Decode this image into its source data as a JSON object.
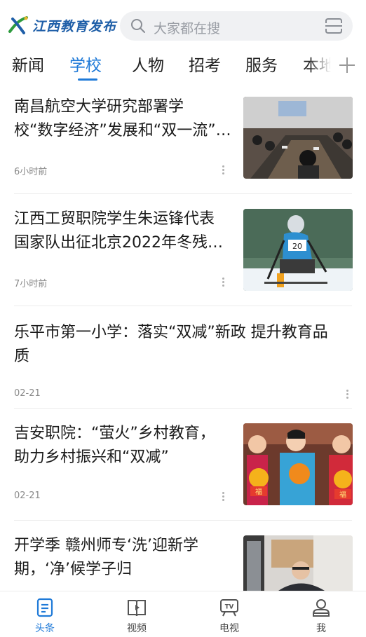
{
  "brand": {
    "name": "江西教育发布",
    "accent": "#1f7ad8"
  },
  "search": {
    "placeholder": "大家都在搜"
  },
  "tabs": [
    {
      "label": "新闻",
      "active": false
    },
    {
      "label": "学校",
      "active": true
    },
    {
      "label": "人物",
      "active": false
    },
    {
      "label": "招考",
      "active": false
    },
    {
      "label": "服务",
      "active": false
    },
    {
      "label": "本地",
      "active": false
    }
  ],
  "feed": [
    {
      "title_line1": "南昌航空大学研究部署学",
      "title_line2": "校“数字经济”发展和“双一流”…",
      "time": "6小时前",
      "has_image": true,
      "image": "meeting-photo"
    },
    {
      "title_line1": "江西工贸职院学生朱运锋代表",
      "title_line2": "国家队出征北京2022年冬残…",
      "time": "7小时前",
      "has_image": true,
      "image": "para-skier-photo",
      "bib": "20"
    },
    {
      "title_line1": "乐平市第一小学：落实“双减”新政  提升教育品",
      "title_line2": "质",
      "time": "02-21",
      "has_image": false
    },
    {
      "title_line1": "吉安职院：“萤火”乡村教育，",
      "title_line2": "助力乡村振兴和“双减”",
      "time": "02-21",
      "has_image": true,
      "image": "children-crafts-photo",
      "craft_text": "福"
    },
    {
      "title_line1": "开学季 赣州师专‘洗’迎新学",
      "title_line2": "期，‘净’候学子归",
      "time": "",
      "has_image": true,
      "image": "cleaning-photo"
    }
  ],
  "bottom_nav": [
    {
      "label": "头条",
      "icon": "headline-icon",
      "active": true
    },
    {
      "label": "视频",
      "icon": "video-icon",
      "active": false
    },
    {
      "label": "电视",
      "icon": "tv-icon",
      "active": false,
      "icon_text": "TV"
    },
    {
      "label": "我",
      "icon": "profile-icon",
      "active": false
    }
  ]
}
